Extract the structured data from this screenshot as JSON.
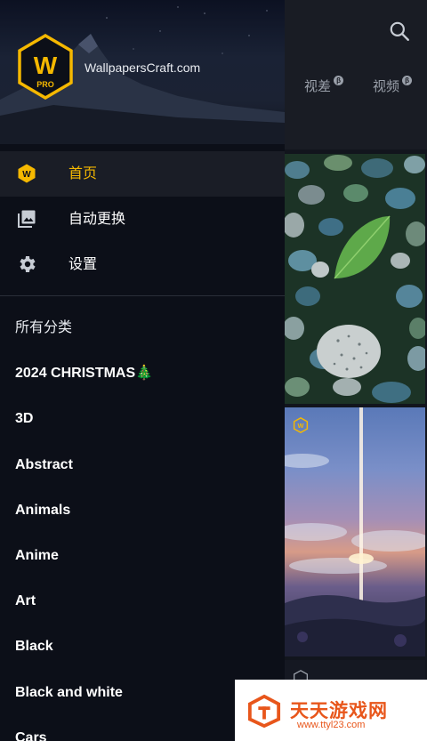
{
  "background": {
    "tabs": [
      {
        "label": "视差",
        "badge": "β"
      },
      {
        "label": "视频",
        "badge": "β"
      }
    ]
  },
  "drawer": {
    "brand": "WallpapersCraft.com",
    "logo_letter": "W",
    "logo_sub": "PRO",
    "menu": [
      {
        "label": "首页",
        "icon": "wallpaperscraft-logo-icon",
        "active": true
      },
      {
        "label": "自动更换",
        "icon": "image-stack-icon",
        "active": false
      },
      {
        "label": "设置",
        "icon": "gear-icon",
        "active": false
      }
    ],
    "categories_heading": "所有分类",
    "categories": [
      "2024 CHRISTMAS🎄",
      "3D",
      "Abstract",
      "Animals",
      "Anime",
      "Art",
      "Black",
      "Black and white",
      "Cars"
    ]
  },
  "watermark": {
    "title": "天天游戏网",
    "url": "www.ttyl23.com"
  },
  "colors": {
    "accent": "#f5b800",
    "drawer_bg": "#0c0f18",
    "active_row": "#1a1d26",
    "watermark": "#e8561b"
  }
}
